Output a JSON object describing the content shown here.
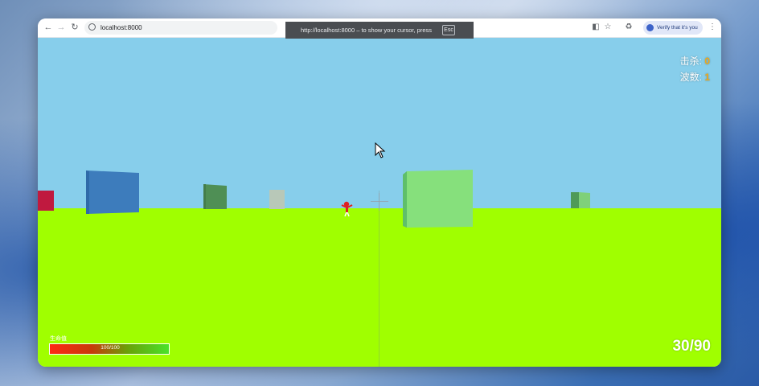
{
  "browser": {
    "url": "localhost:8000",
    "fullscreen_notice": {
      "text": "http://localhost:8000 – to show your cursor, press",
      "key": "Esc"
    },
    "verify_button": "Verify that it's you"
  },
  "hud": {
    "kills_label": "击杀:",
    "kills_value": "0",
    "wave_label": "波数:",
    "wave_value": "1",
    "health_label": "生命值",
    "health_text": "100/100",
    "health_fraction": 1.0,
    "ammo": "30/90"
  },
  "icons": [
    "back-icon",
    "forward-icon",
    "reload-icon",
    "site-info-icon",
    "translate-icon",
    "bookmark-star-icon",
    "extensions-icon",
    "profile-icon",
    "menu-icon",
    "crosshair-icon",
    "mouse-cursor-icon"
  ],
  "colors": {
    "sky": "#87ceeb",
    "ground": "#a0ff00",
    "hud_value": "#f0a818"
  }
}
